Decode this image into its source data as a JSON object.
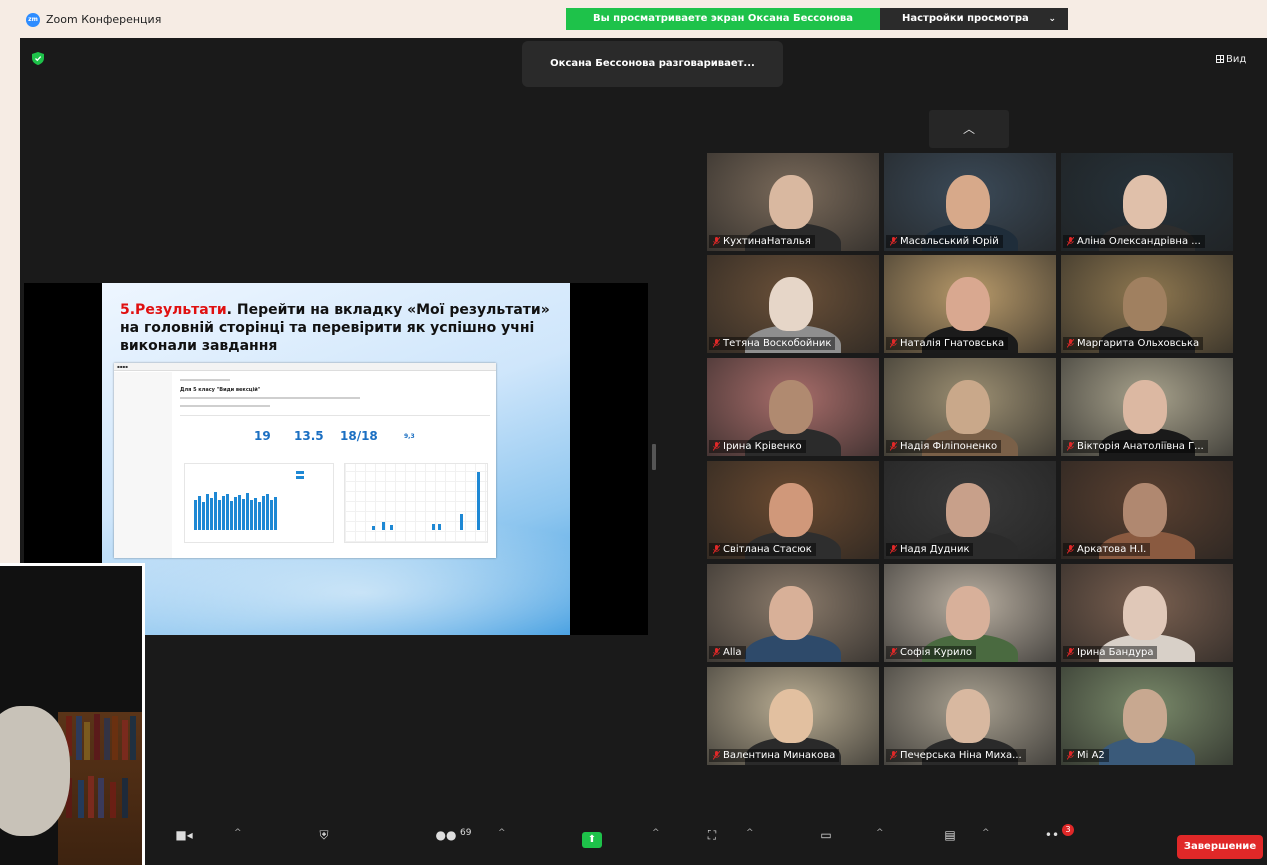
{
  "app": {
    "title": "Zoom Конференция",
    "logo": "zm"
  },
  "banner": {
    "sharing": "Вы просматриваете экран Оксана Бессонова",
    "view_settings": "Настройки просмотра"
  },
  "speaker": "Оксана Бессонова разговаривает...",
  "view_label": "Вид",
  "slide": {
    "heading_red": "5.Результати",
    "heading_rest": ". Перейти на вкладку «Мої результати» на головній сторінці та перевірити як успішно учні виконали завдання",
    "shot_title": "Для 5 класу \"Види вексцій\"",
    "stats": [
      "19",
      "13.5",
      "18/18",
      "9,3"
    ]
  },
  "participants": [
    {
      "name": "КухтинаНаталья",
      "bg": "#7a6a5a",
      "face": "#d9b8a0",
      "shirt": "#2a2a2a"
    },
    {
      "name": "Масальський Юрій",
      "bg": "#3b4a58",
      "face": "#d7a98a",
      "shirt": "#1f2d3a"
    },
    {
      "name": "Аліна Олександрівна ...",
      "bg": "#26323a",
      "face": "#e0c0aa",
      "shirt": "#2d2d2d"
    },
    {
      "name": "Тетяна Воскобойник",
      "bg": "#6a5038",
      "face": "#e6d6c8",
      "shirt": "#8f8f8f"
    },
    {
      "name": "Наталія Гнатовська",
      "bg": "#b89a6a",
      "face": "#d9a890",
      "shirt": "#1b1b1b"
    },
    {
      "name": "Маргарита Ольховська",
      "bg": "#8f7850",
      "face": "#a08060",
      "shirt": "#222"
    },
    {
      "name": "Ірина Крівенко",
      "bg": "#a86d6a",
      "face": "#b08a70",
      "shirt": "#2b2b2b"
    },
    {
      "name": "Надія Філіпоненко",
      "bg": "#9c8f72",
      "face": "#c9a88a",
      "shirt": "#7a6048"
    },
    {
      "name": "Вікторія Анатоліївна Г...",
      "bg": "#a8a28c",
      "face": "#dcb8a2",
      "shirt": "#1a1a1a"
    },
    {
      "name": "Світлана Стасюк",
      "bg": "#6a4a30",
      "face": "#d0987a",
      "shirt": "#2e2e2e"
    },
    {
      "name": "Надя Дудник",
      "bg": "#3a3a3a",
      "face": "#c8a08a",
      "shirt": "#2b2b2b"
    },
    {
      "name": "Аркатова Н.І.",
      "bg": "#5a4030",
      "face": "#b08870",
      "shirt": "#8a5a40"
    },
    {
      "name": "Alla",
      "bg": "#8a7a6a",
      "face": "#d8b098",
      "shirt": "#2e4a6a"
    },
    {
      "name": "Софія Курило",
      "bg": "#b8aea0",
      "face": "#d8b09a",
      "shirt": "#4a6a40"
    },
    {
      "name": "Ірина Бандура",
      "bg": "#7a6050",
      "face": "#e0c8b8",
      "shirt": "#d8d0c8"
    },
    {
      "name": "Валентина Минакова",
      "bg": "#b8ac92",
      "face": "#e2c0a0",
      "shirt": "#2a2a2a"
    },
    {
      "name": "Печерська Ніна Миха...",
      "bg": "#a8a090",
      "face": "#d8b8a0",
      "shirt": "#2a2a2a"
    },
    {
      "name": "Mi A2",
      "bg": "#7a8a6a",
      "face": "#c8a890",
      "shirt": "#3a5a7a"
    }
  ],
  "toolbar": {
    "participants_count": "69",
    "more_badge": "3",
    "end_label": "Завершение"
  },
  "colors": {
    "accent_green": "#1ec24a",
    "danger_red": "#e02828",
    "zoom_blue": "#2d8cff"
  }
}
